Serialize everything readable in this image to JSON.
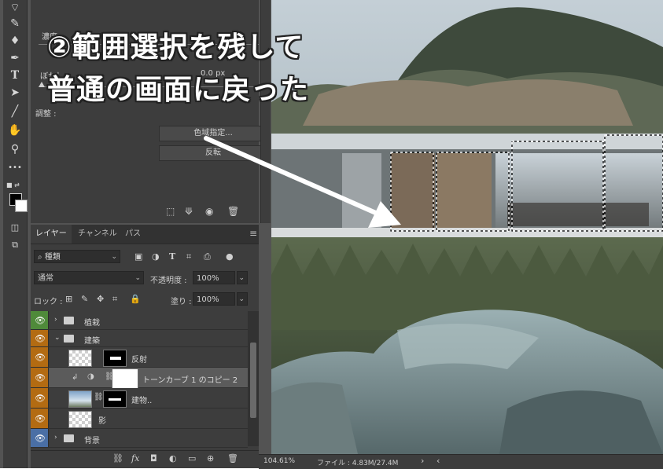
{
  "caption": {
    "line1": "②範囲選択を残して",
    "line2": "普通の画面に戻った"
  },
  "properties": {
    "density_label": "濃度",
    "feather_label": "ぼかし :",
    "feather_value": "0.0 px",
    "refine_label": "調整 :",
    "color_range_button": "色域指定...",
    "invert_button": "反転"
  },
  "layers_panel": {
    "tabs": [
      "レイヤー",
      "チャンネル",
      "パス"
    ],
    "filter_kind": "種類",
    "blend_mode": "通常",
    "opacity_label": "不透明度 :",
    "opacity_value": "100%",
    "lock_label": "ロック :",
    "fill_label": "塗り :",
    "fill_value": "100%",
    "layers": [
      {
        "name": "植栽",
        "type": "group",
        "tag_color": "#4f8a3a"
      },
      {
        "name": "建築",
        "type": "group",
        "tag_color": "#b36b12"
      },
      {
        "name": "反射",
        "type": "layer",
        "tag_color": "#b36b12"
      },
      {
        "name": "トーンカーブ 1 のコピー 2",
        "type": "adjustment",
        "tag_color": "#b36b12"
      },
      {
        "name": "建物..",
        "type": "layer",
        "tag_color": "#b36b12"
      },
      {
        "name": "影",
        "type": "layer",
        "tag_color": "#b36b12"
      },
      {
        "name": "背景",
        "type": "group",
        "tag_color": "#4a6fa5"
      }
    ]
  },
  "toolbar": {
    "icons": [
      "lasso-icon",
      "brush-icon",
      "clone-stamp-icon",
      "pen-icon",
      "type-icon",
      "path-select-icon",
      "line-icon",
      "hand-icon",
      "zoom-icon",
      "more-icon"
    ],
    "type_glyph": "T",
    "more_glyph": "•••"
  },
  "status": {
    "zoom": "104.61%",
    "file_info": "ファイル : 4.83M/27.4M",
    "next": "›",
    "prev": "‹"
  }
}
